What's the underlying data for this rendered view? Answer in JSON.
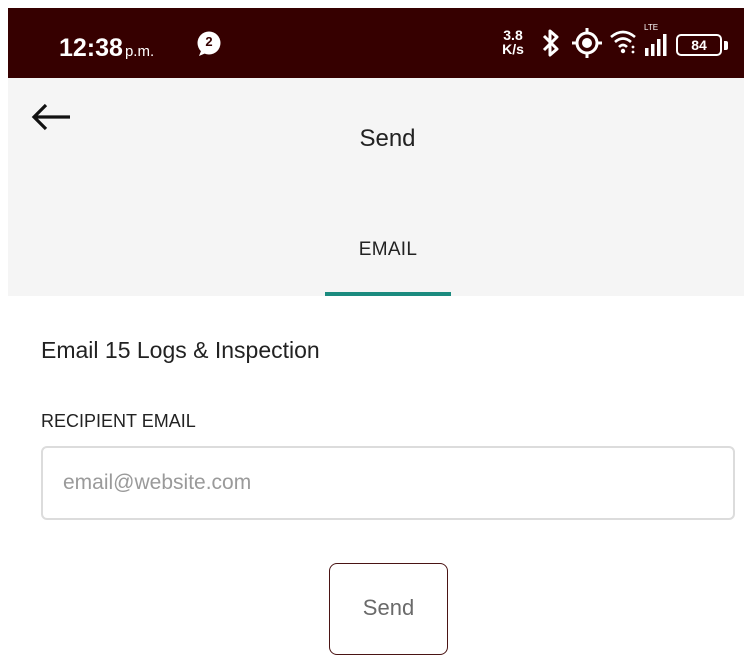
{
  "status_bar": {
    "time": "12:38",
    "ampm": "p.m.",
    "notification_count": "2",
    "net_speed_value": "3.8",
    "net_speed_unit": "K/s",
    "network_type": "LTE",
    "battery_level": "84",
    "background_color": "#360000"
  },
  "header": {
    "title": "Send",
    "back_icon": "arrow-left-icon"
  },
  "tabs": [
    {
      "label": "EMAIL",
      "selected": true
    }
  ],
  "accent_color": "#1b8b7f",
  "form": {
    "section_title": "Email 15 Logs & Inspection",
    "recipient_label": "RECIPIENT EMAIL",
    "email_placeholder": "email@website.com",
    "email_value": "",
    "send_label": "Send"
  }
}
